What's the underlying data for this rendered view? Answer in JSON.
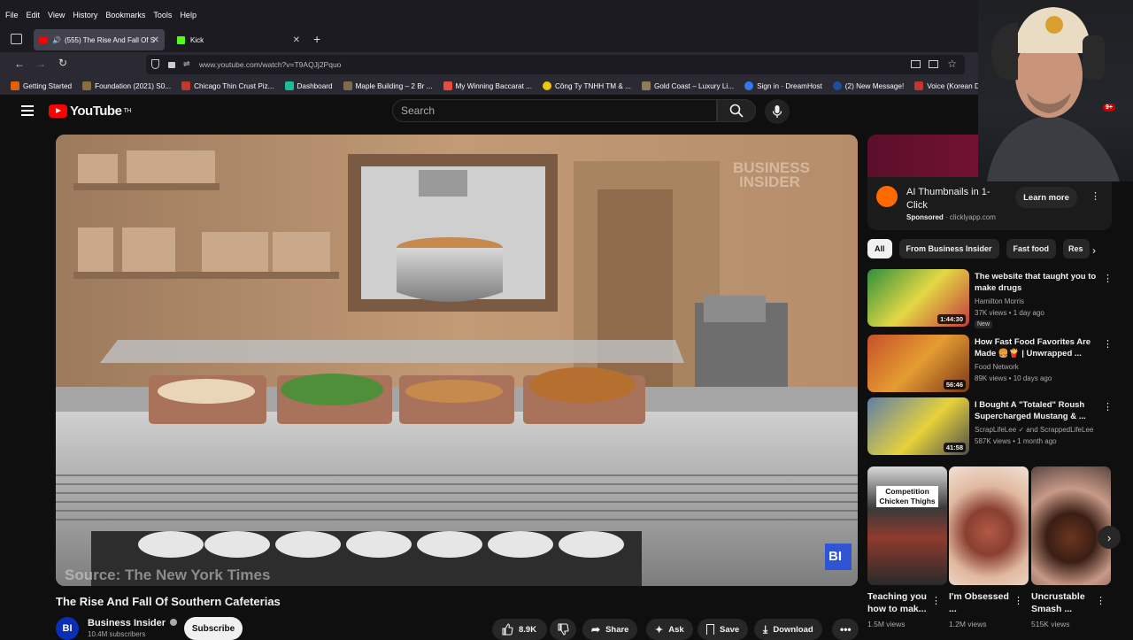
{
  "menubar": {
    "items": [
      "File",
      "Edit",
      "View",
      "History",
      "Bookmarks",
      "Tools",
      "Help"
    ]
  },
  "tabs": [
    {
      "label": "(555) The Rise And Fall Of S"
    },
    {
      "label": "Kick"
    }
  ],
  "url": "www.youtube.com/watch?v=T9AQJj2Pquo",
  "bookmarks": [
    {
      "label": "Getting Started",
      "color": "#e66000"
    },
    {
      "label": "Foundation (2021) S0...",
      "color": "#8a6d3b"
    },
    {
      "label": "Chicago Thin Crust Piz...",
      "color": "#c0392b"
    },
    {
      "label": "Dashboard",
      "color": "#1abc9c"
    },
    {
      "label": "Maple Building – 2 Br ...",
      "color": "#7f6a4d"
    },
    {
      "label": "My Winning Baccarat ...",
      "color": "#e74c3c"
    },
    {
      "label": "Công Ty TNHH TM & ...",
      "color": "#f1c40f"
    },
    {
      "label": "Gold Coast – Luxury Li...",
      "color": "#8d7b5a"
    },
    {
      "label": "Sign in · DreamHost",
      "color": "#3478f6"
    },
    {
      "label": "(2) New Message!",
      "color": "#1b4fa0"
    },
    {
      "label": "Voice (Korean Drama)",
      "color": "#c0392b"
    }
  ],
  "header": {
    "logo": "YouTube",
    "logo_sup": "TH",
    "search_placeholder": "Search",
    "notif_count": "9+"
  },
  "video": {
    "watermark": "BUSINESS\nINSIDER",
    "source": "Source: The New York Times",
    "corner_logo": "BI",
    "title": "The Rise And Fall Of Southern Cafeterias",
    "channel": "Business Insider",
    "subscribers": "10.4M subscribers",
    "subscribe_label": "Subscribe",
    "likes": "8.9K",
    "share_label": "Share",
    "ask_label": "Ask",
    "save_label": "Save",
    "download_label": "Download"
  },
  "ad": {
    "title": "AI Thumbnails in 1-Click",
    "sponsored": "Sponsored",
    "domain": "clicklyapp.com",
    "cta": "Learn more"
  },
  "chips": [
    "All",
    "From Business Insider",
    "Fast food",
    "Res"
  ],
  "recommendations": [
    {
      "title": "The website that taught you to make drugs",
      "channel": "Hamilton Morris",
      "meta": "37K views • 1 day ago",
      "duration": "1:44:30",
      "badge": "New"
    },
    {
      "title": "How Fast Food Favorites Are Made 🍔🍟 | Unwrapped ...",
      "channel": "Food Network",
      "meta": "89K views • 10 days ago",
      "duration": "56:46"
    },
    {
      "title": "I Bought A \"Totaled\" Roush Supercharged Mustang & ...",
      "channel": "ScrapLifeLee ✓ and ScrappedLifeLee",
      "meta": "587K views • 1 month ago",
      "duration": "41:58"
    }
  ],
  "shorts": [
    {
      "title": "Teaching you how to mak...",
      "views": "1.5M views",
      "overlay": "Competition Chicken Thighs"
    },
    {
      "title": "I'm Obsessed ...",
      "views": "1.2M views"
    },
    {
      "title": "Uncrustable Smash ...",
      "views": "515K views"
    }
  ]
}
